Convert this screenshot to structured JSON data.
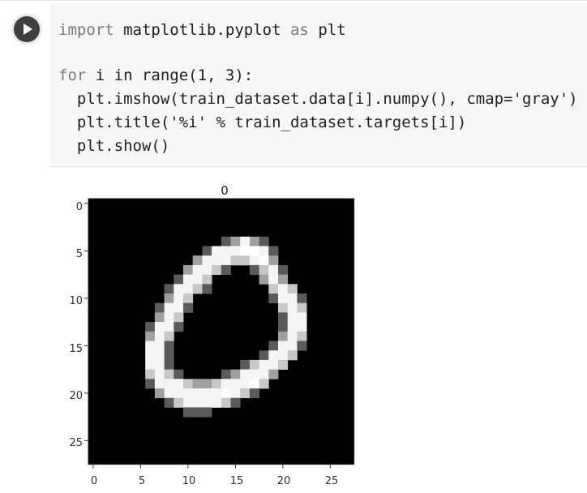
{
  "code_cell": {
    "run_button_icon": "play-icon",
    "lines": [
      {
        "kw": "import",
        "rest1": " matplotlib.pyplot ",
        "kw2": "as",
        "rest2": " plt"
      },
      {
        "text": ""
      },
      {
        "kw": "for",
        "rest1": " i in range(1, 3):"
      },
      {
        "text": "  plt.imshow(train_dataset.data[i].numpy(), cmap='gray')"
      },
      {
        "text": "  plt.title('%i' % train_dataset.targets[i])"
      },
      {
        "text": "  plt.show()"
      }
    ]
  },
  "output": {
    "plot_title": "0",
    "y_ticks": [
      "0",
      "5",
      "10",
      "15",
      "20",
      "25"
    ],
    "x_ticks": [
      "0",
      "5",
      "10",
      "15",
      "20",
      "25"
    ]
  },
  "chart_data": {
    "type": "heatmap",
    "title": "0",
    "colormap": "gray",
    "xlim": [
      -0.5,
      27.5
    ],
    "ylim": [
      27.5,
      -0.5
    ],
    "x_ticks": [
      0,
      5,
      10,
      15,
      20,
      25
    ],
    "y_ticks": [
      0,
      5,
      10,
      15,
      20,
      25
    ],
    "image_rows": [
      "............................",
      "............................",
      "............................",
      "............................",
      "..............:o#o:.........",
      "............:###@@#:........",
      "...........o###++#@o........",
      "..........o##+:..:+#:.......",
      ".........:##+.....o#o.......",
      "........:##+:......+#+......",
      "........o#+........:##:.....",
      ".......:##:.........+#+.....",
      ".......o#+..........:##.....",
      "......:##:..........:##.....",
      "......o#+...........o#+.....",
      "......##:..........:##:.....",
      "......##:.........:##+......",
      "......##:.......:+##+.......",
      "......+#+:....:o###o........",
      "......:###+oo+###@+.........",
      ".......o######@#+:..........",
      "........:+####+:............",
      "..........:::...............",
      "............................",
      "............................",
      "............................",
      "............................",
      "............................"
    ],
    "pixel_levels": {
      ".": 0,
      ":": 90,
      "o": 160,
      "+": 200,
      "#": 245,
      "@": 255
    }
  }
}
